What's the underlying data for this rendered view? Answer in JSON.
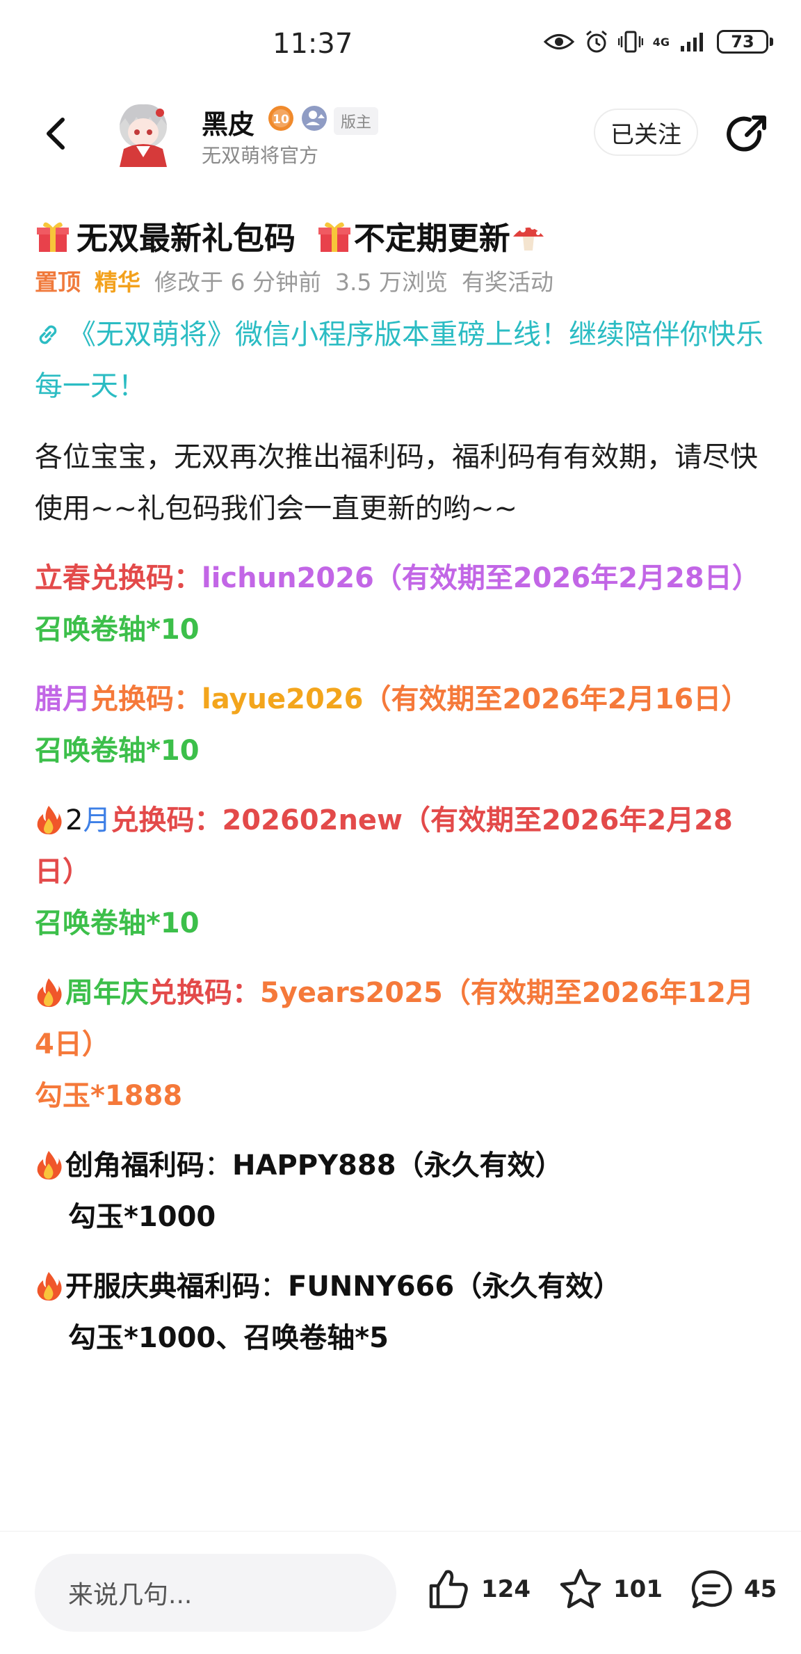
{
  "status_bar": {
    "time": "11:37",
    "network": "4G",
    "battery": "73"
  },
  "header": {
    "username": "黑皮",
    "level_badge": "10",
    "role_tag": "版主",
    "subtitle": "无双萌将官方",
    "follow_label": "已关注"
  },
  "post": {
    "title": "无双最新礼包码",
    "title_suffix": "不定期更新",
    "meta": {
      "pinned": "置顶",
      "featured": "精华",
      "edited": "修改于 6 分钟前",
      "views": "3.5 万浏览",
      "activity": "有奖活动"
    },
    "link_text": "《无双萌将》微信小程序版本重磅上线！继续陪伴你快乐每一天！",
    "intro": "各位宝宝，无双再次推出福利码，福利码有有效期，请尽快使用~~礼包码我们会一直更新的哟~~",
    "codes": [
      {
        "label_a": "立春兑换码：",
        "code": "lichun2026（有效期至2026年2月28日）",
        "reward": "召唤卷轴*10"
      },
      {
        "label_a": "腊月",
        "label_b": "兑换码：",
        "code": "layue2026",
        "validity": "（有效期至2026年2月16日）",
        "reward": "召唤卷轴*10"
      },
      {
        "label_a": "2",
        "label_b": "月",
        "label_c": "兑换码：",
        "code": "202602new（有效期至2026年2月28日）",
        "reward": "召唤卷轴*10"
      },
      {
        "label_a": "周年庆",
        "label_b": "兑换码：",
        "code": "5years2025（有效期至2026年12月4日）",
        "reward": "勾玉*1888"
      },
      {
        "label_a": "创角福利码",
        "sep": "：",
        "code": "HAPPY888（永久有效）",
        "reward": "勾玉*1000"
      },
      {
        "label_a": "开服庆典福利码",
        "sep": "：",
        "code": "FUNNY666（永久有效）",
        "reward": "勾玉*1000、召唤卷轴*5"
      }
    ]
  },
  "bottom_bar": {
    "comment_placeholder": "来说几句...",
    "likes": "124",
    "favorites": "101",
    "comments": "45"
  },
  "colors": {
    "red": "#e34a4a",
    "purple": "#c266e6",
    "green": "#3cbf4a",
    "orange": "#f5793a",
    "yellow": "#f3a51c",
    "blue": "#3d7fe6",
    "teal": "#2bbcc3"
  }
}
